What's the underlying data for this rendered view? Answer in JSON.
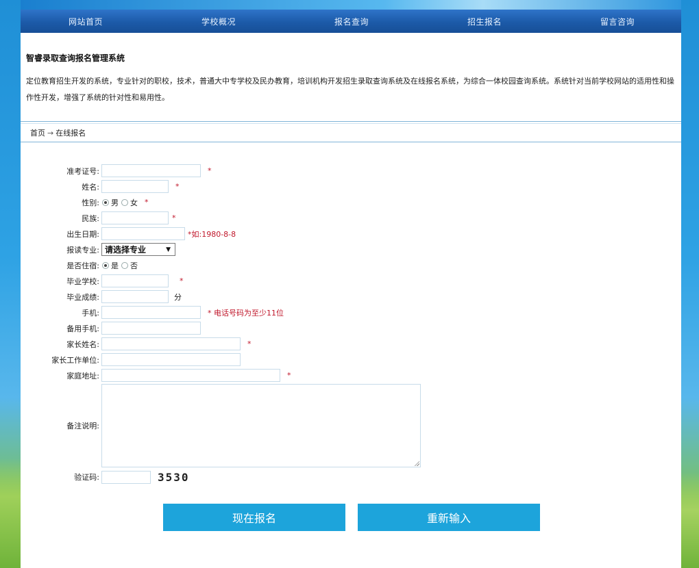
{
  "nav": {
    "items": [
      "网站首页",
      "学校概况",
      "报名查询",
      "招生报名",
      "留言咨询"
    ]
  },
  "intro": {
    "title": "智睿录取查询报名管理系统",
    "text": "定位教育招生开发的系统，专业针对的职校，技术，普通大中专学校及民办教育，培训机构开发招生录取查询系统及在线报名系统，为综合一体校园查询系统。系统针对当前学校网站的适用性和操作性开发，增强了系统的针对性和易用性。"
  },
  "breadcrumb": {
    "home": "首页",
    "separator": "→",
    "current": "在线报名"
  },
  "form": {
    "exam_no": {
      "label": "准考证号:",
      "required": "*"
    },
    "name": {
      "label": "姓名:",
      "required": "*"
    },
    "gender": {
      "label": "性别:",
      "options": [
        "男",
        "女"
      ],
      "selected": "男",
      "required": "*"
    },
    "ethnicity": {
      "label": "民族:",
      "required": "*"
    },
    "birth": {
      "label": "出生日期:",
      "hint": "*如:1980-8-8"
    },
    "major": {
      "label": "报读专业:",
      "selected": "请选择专业"
    },
    "boarding": {
      "label": "是否住宿:",
      "options": [
        "是",
        "否"
      ],
      "selected": "是"
    },
    "school": {
      "label": "毕业学校:",
      "required": "*"
    },
    "score": {
      "label": "毕业成绩:",
      "unit": "分"
    },
    "phone": {
      "label": "手机:",
      "hint": "* 电话号码为至少11位"
    },
    "phone2": {
      "label": "备用手机:"
    },
    "parent": {
      "label": "家长姓名:",
      "required": "*"
    },
    "parent_work": {
      "label": "家长工作单位:"
    },
    "address": {
      "label": "家庭地址:",
      "required": "*"
    },
    "remark": {
      "label": "备注说明:"
    },
    "captcha": {
      "label": "验证码:",
      "code": "3530"
    }
  },
  "buttons": {
    "submit": "现在报名",
    "reset": "重新输入"
  },
  "colors": {
    "nav": "#1c5aa8",
    "button": "#1da4db",
    "required": "#c0162a"
  }
}
